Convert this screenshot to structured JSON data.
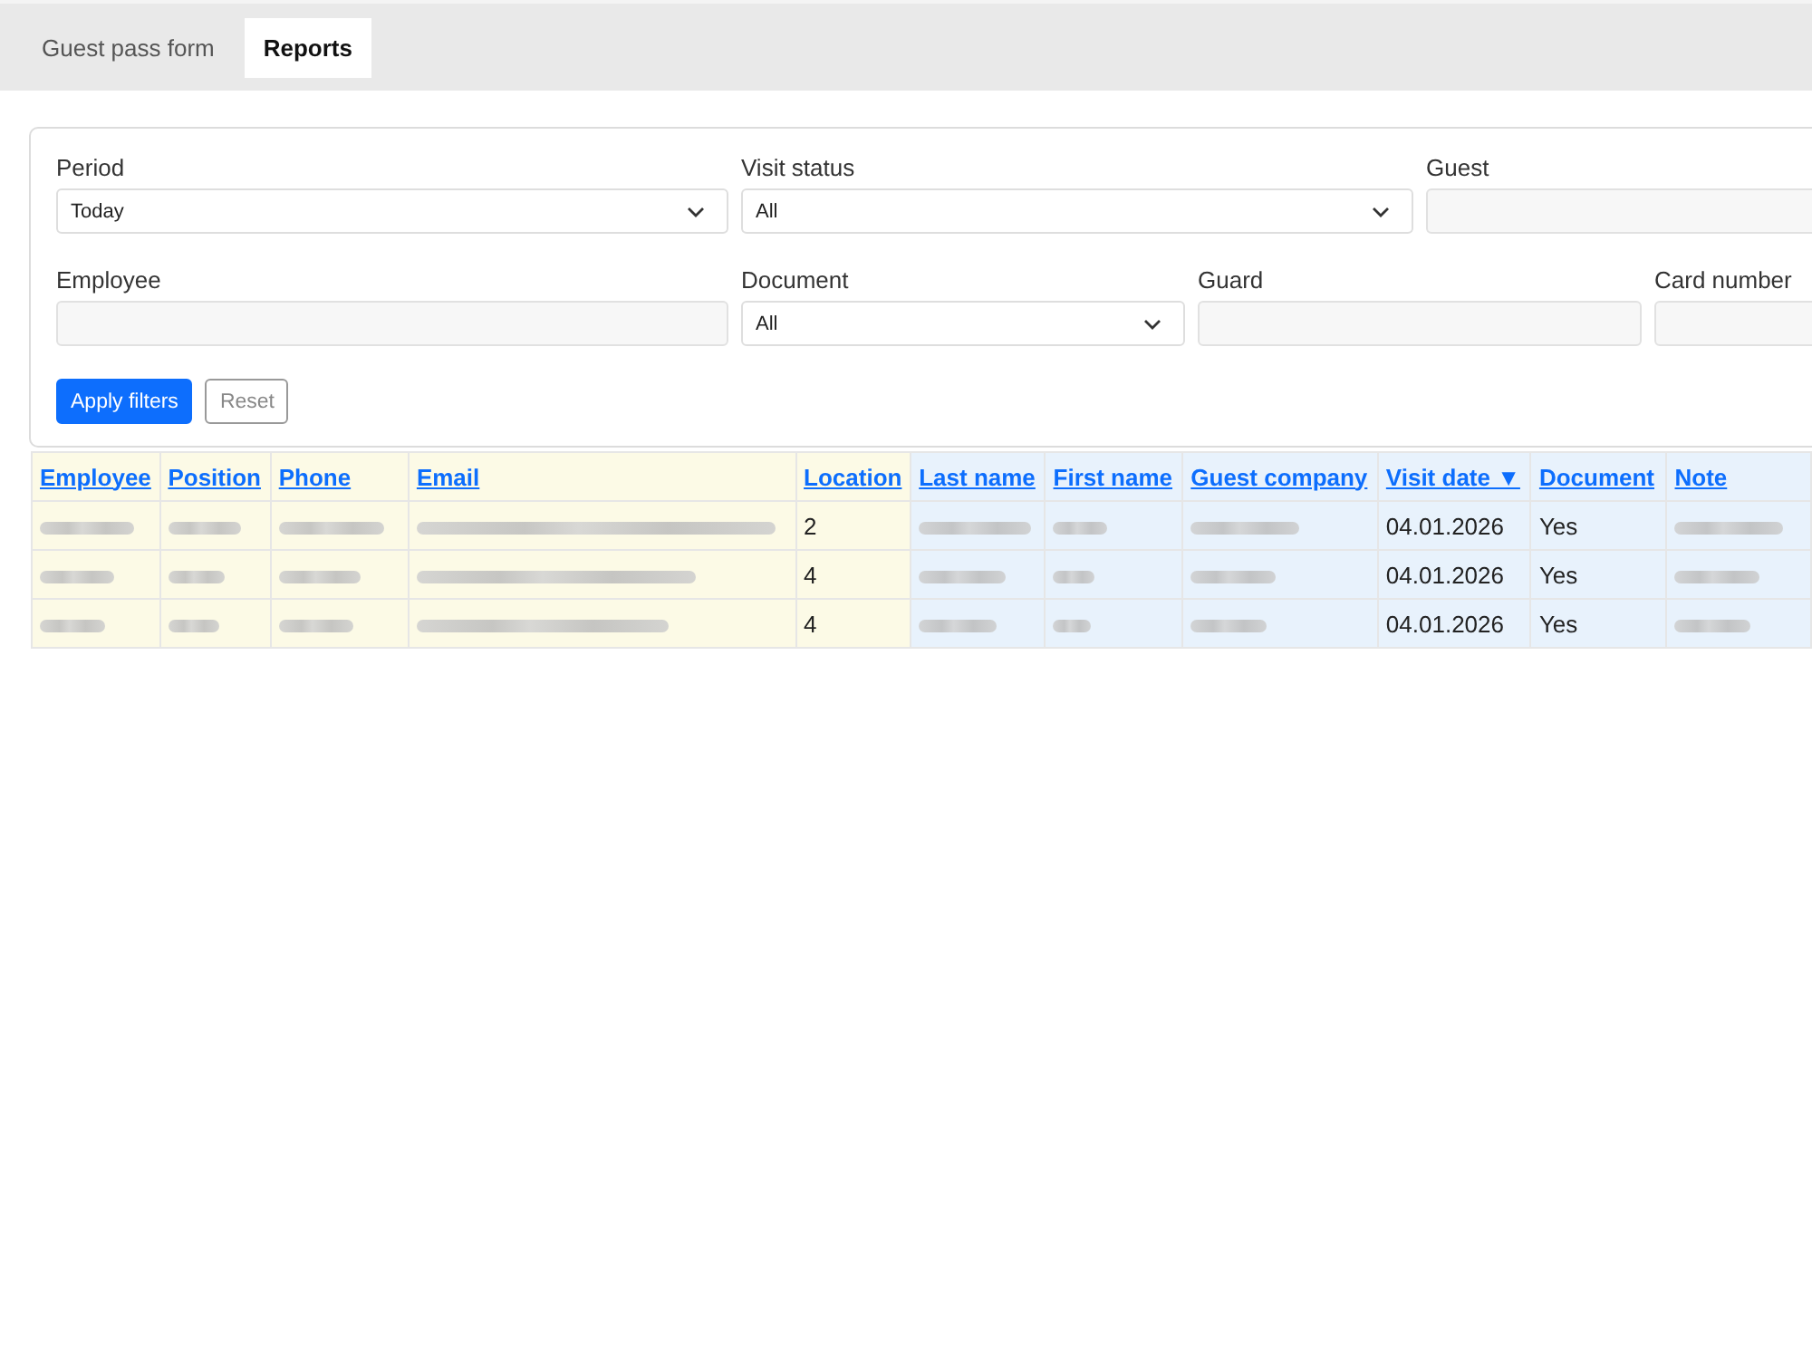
{
  "tabs": [
    {
      "label": "Guest pass form",
      "selected": false
    },
    {
      "label": "Reports",
      "selected": true
    }
  ],
  "filters": {
    "rows": [
      [
        {
          "kind": "select",
          "label": "Period",
          "value": "Today"
        },
        {
          "kind": "select",
          "label": "Visit status",
          "value": "All"
        },
        {
          "kind": "text",
          "label": "Guest"
        }
      ],
      [
        {
          "kind": "text",
          "label": "Employee"
        },
        {
          "kind": "select",
          "label": "Document",
          "value": "All"
        },
        {
          "kind": "text",
          "label": "Guard"
        },
        {
          "kind": "text",
          "label": "Card number"
        }
      ]
    ],
    "buttons": [
      {
        "kind": "primary",
        "label": "Apply filters"
      },
      {
        "kind": "secondary",
        "label": "Reset"
      }
    ]
  },
  "table": {
    "columns": [
      {
        "label": "Employee",
        "color": "#fcfae6"
      },
      {
        "label": "Position",
        "color": "#fcfae6"
      },
      {
        "label": "Phone",
        "color": "#fcfae6"
      },
      {
        "label": "Email",
        "color": "#fcfae6"
      },
      {
        "label": "Location",
        "color": "#fcfae6"
      },
      {
        "label": "Last name",
        "color": "#e8f2fc"
      },
      {
        "label": "First name",
        "color": "#e8f2fc"
      },
      {
        "label": "Guest company",
        "color": "#e8f2fc"
      },
      {
        "label": "Visit date ▼",
        "color": "#e8f2fc"
      },
      {
        "label": "Document",
        "color": "#e8f2fc"
      },
      {
        "label": "Note",
        "color": "#e8f2fc"
      }
    ],
    "rows": [
      [
        {
          "kind": "redacted"
        },
        {
          "kind": "redacted"
        },
        {
          "kind": "redacted"
        },
        {
          "kind": "redacted"
        },
        {
          "kind": "text",
          "text": "2"
        },
        {
          "kind": "redacted"
        },
        {
          "kind": "redacted"
        },
        {
          "kind": "redacted"
        },
        {
          "kind": "text",
          "text": "04.01.2026"
        },
        {
          "kind": "text",
          "text": "Yes"
        },
        {
          "kind": "redacted"
        }
      ],
      [
        {
          "kind": "redacted"
        },
        {
          "kind": "redacted"
        },
        {
          "kind": "redacted"
        },
        {
          "kind": "redacted"
        },
        {
          "kind": "text",
          "text": "4"
        },
        {
          "kind": "redacted"
        },
        {
          "kind": "redacted"
        },
        {
          "kind": "redacted"
        },
        {
          "kind": "text",
          "text": "04.01.2026"
        },
        {
          "kind": "text",
          "text": "Yes"
        },
        {
          "kind": "redacted"
        }
      ],
      [
        {
          "kind": "redacted"
        },
        {
          "kind": "redacted"
        },
        {
          "kind": "redacted"
        },
        {
          "kind": "redacted"
        },
        {
          "kind": "text",
          "text": "4"
        },
        {
          "kind": "redacted"
        },
        {
          "kind": "redacted"
        },
        {
          "kind": "redacted"
        },
        {
          "kind": "text",
          "text": "04.01.2026"
        },
        {
          "kind": "text",
          "text": "Yes"
        },
        {
          "kind": "redacted"
        }
      ]
    ]
  }
}
